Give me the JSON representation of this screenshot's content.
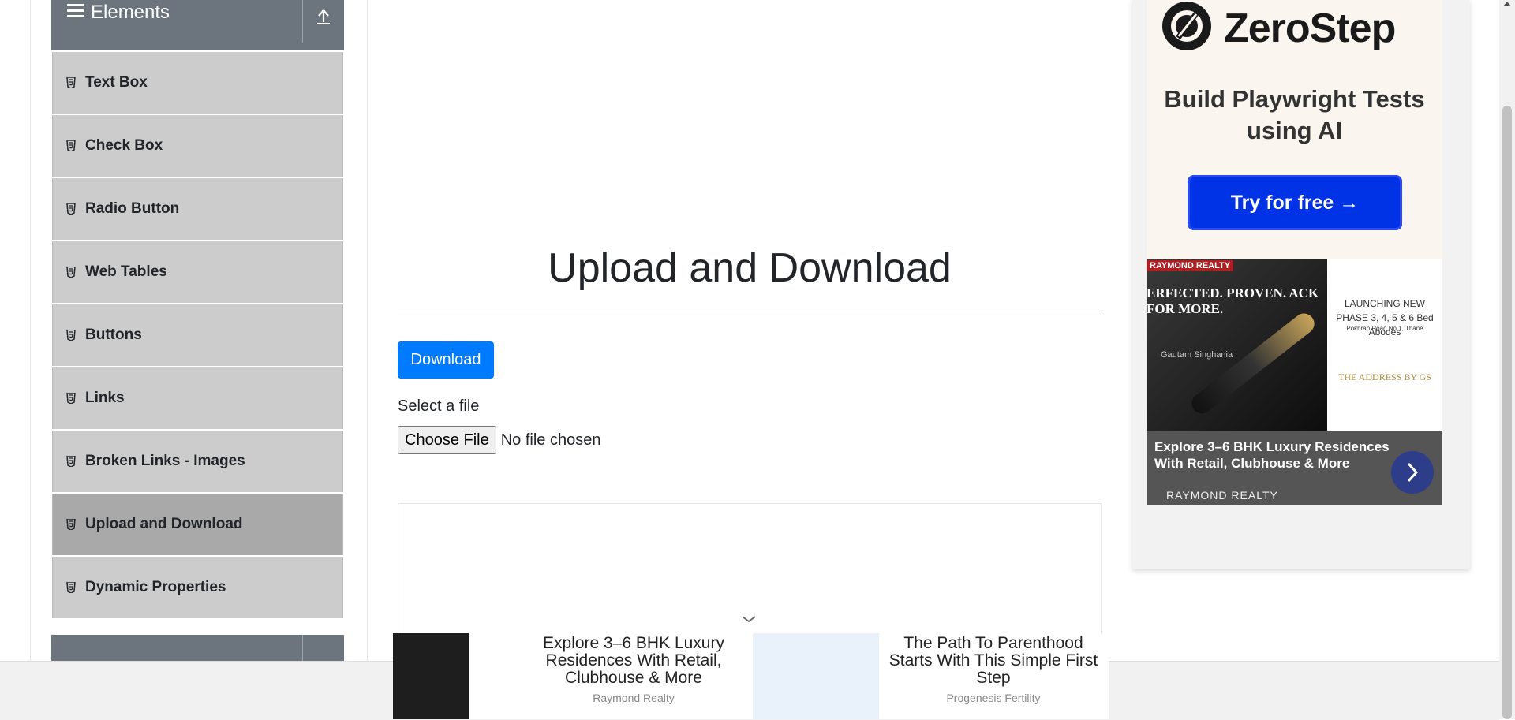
{
  "sidebar": {
    "group_title": "Elements",
    "items": [
      {
        "label": "Text Box",
        "active": false
      },
      {
        "label": "Check Box",
        "active": false
      },
      {
        "label": "Radio Button",
        "active": false
      },
      {
        "label": "Web Tables",
        "active": false
      },
      {
        "label": "Buttons",
        "active": false
      },
      {
        "label": "Links",
        "active": false
      },
      {
        "label": "Broken Links - Images",
        "active": false
      },
      {
        "label": "Upload and Download",
        "active": true
      },
      {
        "label": "Dynamic Properties",
        "active": false
      }
    ]
  },
  "main": {
    "title": "Upload and Download",
    "download_label": "Download",
    "select_label": "Select a file",
    "choose_file_label": "Choose File",
    "file_status": "No file chosen"
  },
  "right_ad": {
    "brand": "ZeroStep",
    "tagline": "Build Playwright Tests using AI",
    "cta": "Try for free →",
    "realty_brand": "RAYMOND REALTY",
    "realty_tag": "ERFECTED. PROVEN. ACK FOR MORE.",
    "realty_sign": "Gautam Singhania",
    "launch": "LAUNCHING NEW PHASE 3, 4, 5 & 6 Bed Abodes",
    "location": "Pokhran Road No.1, Thane",
    "address_by": "THE ADDRESS BY GS",
    "headline": "Explore 3–6 BHK Luxury Residences With Retail, Clubhouse & More",
    "realty_name": "RAYMOND REALTY"
  },
  "bottom_ad": {
    "items": [
      {
        "text": "Explore 3–6 BHK Luxury Residences With Retail, Clubhouse & More",
        "source": "Raymond Realty"
      },
      {
        "text": "The Path To Parenthood Starts With This Simple First Step",
        "source": "Progenesis Fertility"
      }
    ]
  },
  "colors": {
    "accent": "#007bff",
    "sidebar_header": "#6c757d",
    "menu_item": "#cccccc",
    "menu_item_active": "#a9a9a9",
    "zerostep_button": "#0033e6"
  }
}
